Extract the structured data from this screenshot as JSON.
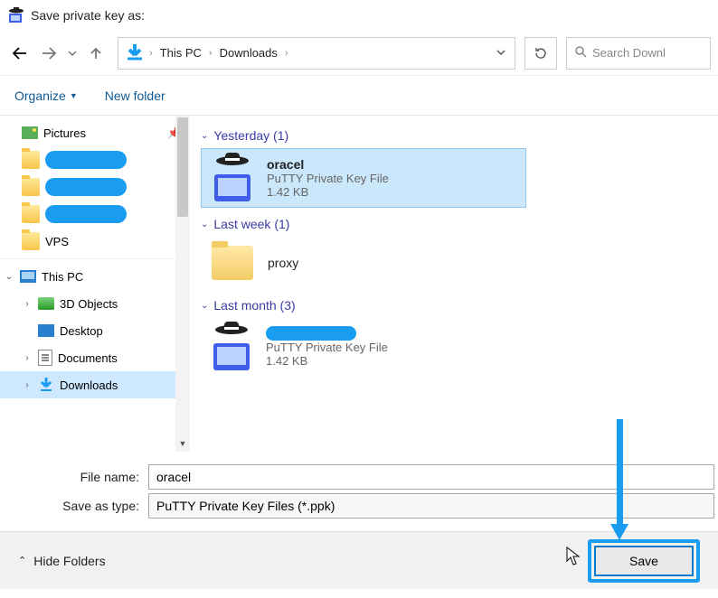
{
  "window": {
    "title": "Save private key as:"
  },
  "nav": {
    "breadcrumbs": [
      "This PC",
      "Downloads"
    ],
    "search_placeholder": "Search Downl"
  },
  "toolbar": {
    "organize": "Organize",
    "newfolder": "New folder"
  },
  "sidebar": {
    "pictures": "Pictures",
    "redacted": [
      "",
      "",
      ""
    ],
    "vps": "VPS",
    "thispc": "This PC",
    "children": [
      {
        "label": "3D Objects",
        "icon": "drv"
      },
      {
        "label": "Desktop",
        "icon": "deskicon"
      },
      {
        "label": "Documents",
        "icon": "docicon"
      },
      {
        "label": "Downloads",
        "icon": "dlarrow"
      }
    ]
  },
  "groups": [
    {
      "header": "Yesterday (1)",
      "items": [
        {
          "name": "oracel",
          "type": "PuTTY Private Key File",
          "size": "1.42 KB",
          "icon": "ppk",
          "selected": true,
          "redacted": false
        }
      ]
    },
    {
      "header": "Last week (1)",
      "items": [
        {
          "name": "proxy",
          "type": "",
          "size": "",
          "icon": "folder",
          "selected": false,
          "redacted": false
        }
      ]
    },
    {
      "header": "Last month (3)",
      "items": [
        {
          "name": "",
          "type": "PuTTY Private Key File",
          "size": "1.42 KB",
          "icon": "ppk",
          "selected": false,
          "redacted": true
        }
      ]
    }
  ],
  "form": {
    "filename_label": "File name:",
    "filename_value": "oracel",
    "type_label": "Save as type:",
    "type_value": "PuTTY Private Key Files (*.ppk)"
  },
  "footer": {
    "hide": "Hide Folders",
    "save": "Save"
  }
}
